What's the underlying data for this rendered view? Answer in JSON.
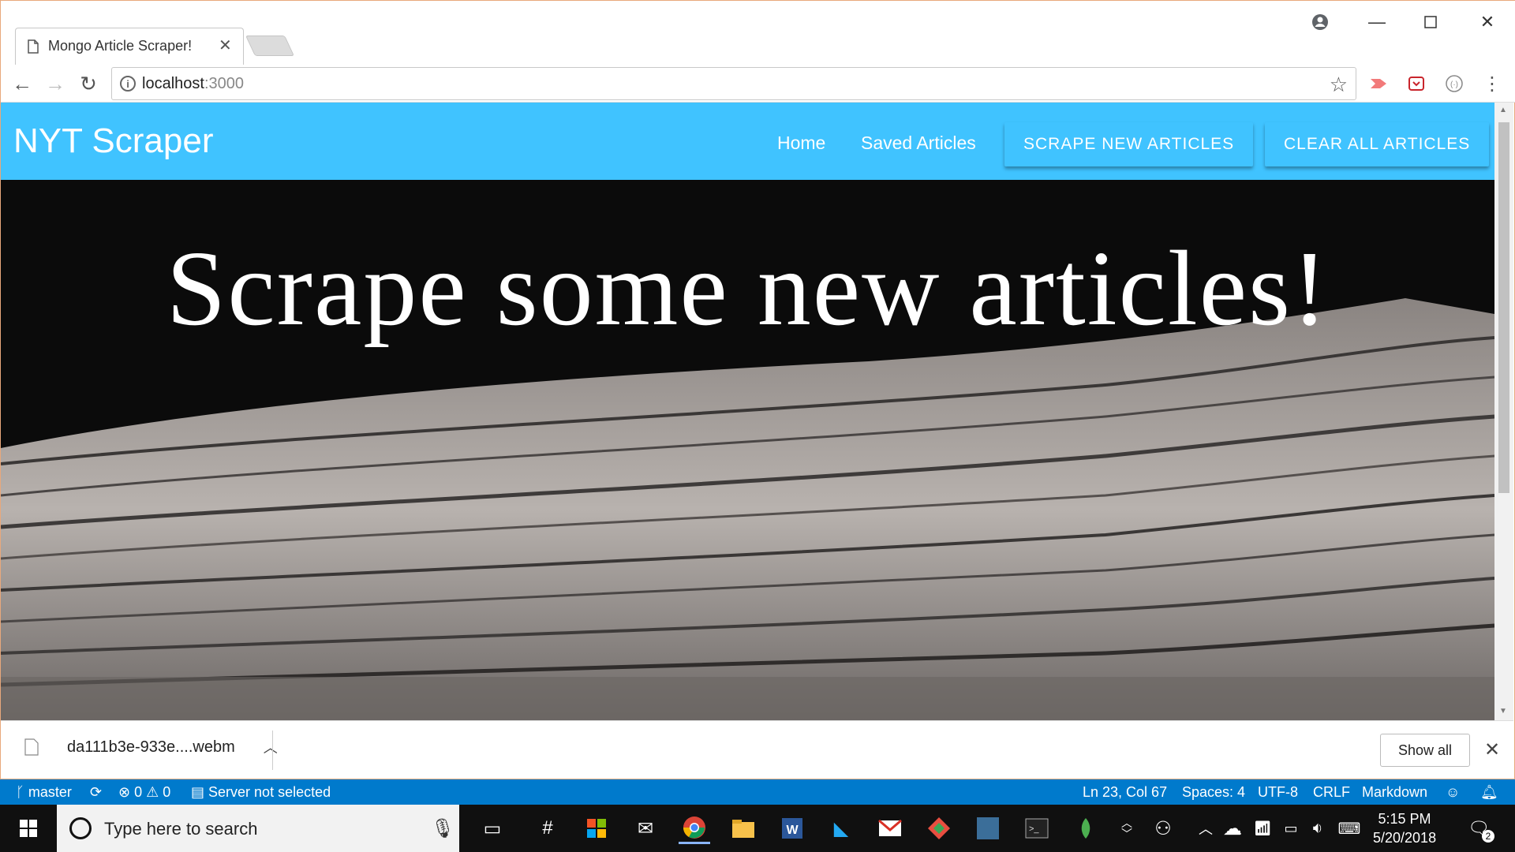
{
  "browser": {
    "tab_title": "Mongo Article Scraper!",
    "url_host": "localhost",
    "url_port": ":3000"
  },
  "page": {
    "brand": "NYT Scraper",
    "nav": {
      "home": "Home",
      "saved": "Saved Articles",
      "scrape_button": "SCRAPE NEW ARTICLES",
      "clear_button": "CLEAR ALL ARTICLES"
    },
    "hero_title": "Scrape some new articles!",
    "accent_color": "#40c3ff"
  },
  "downloads": {
    "filename": "da111b3e-933e....webm",
    "show_all": "Show all"
  },
  "statusbar": {
    "branch": "master",
    "errors": "0",
    "warnings": "0",
    "server": "Server not selected",
    "position": "Ln 23, Col 67",
    "spaces": "Spaces: 4",
    "encoding": "UTF-8",
    "eol": "CRLF",
    "language": "Markdown"
  },
  "taskbar": {
    "search_placeholder": "Type here to search",
    "time": "5:15 PM",
    "date": "5/20/2018",
    "notifications": "2"
  }
}
